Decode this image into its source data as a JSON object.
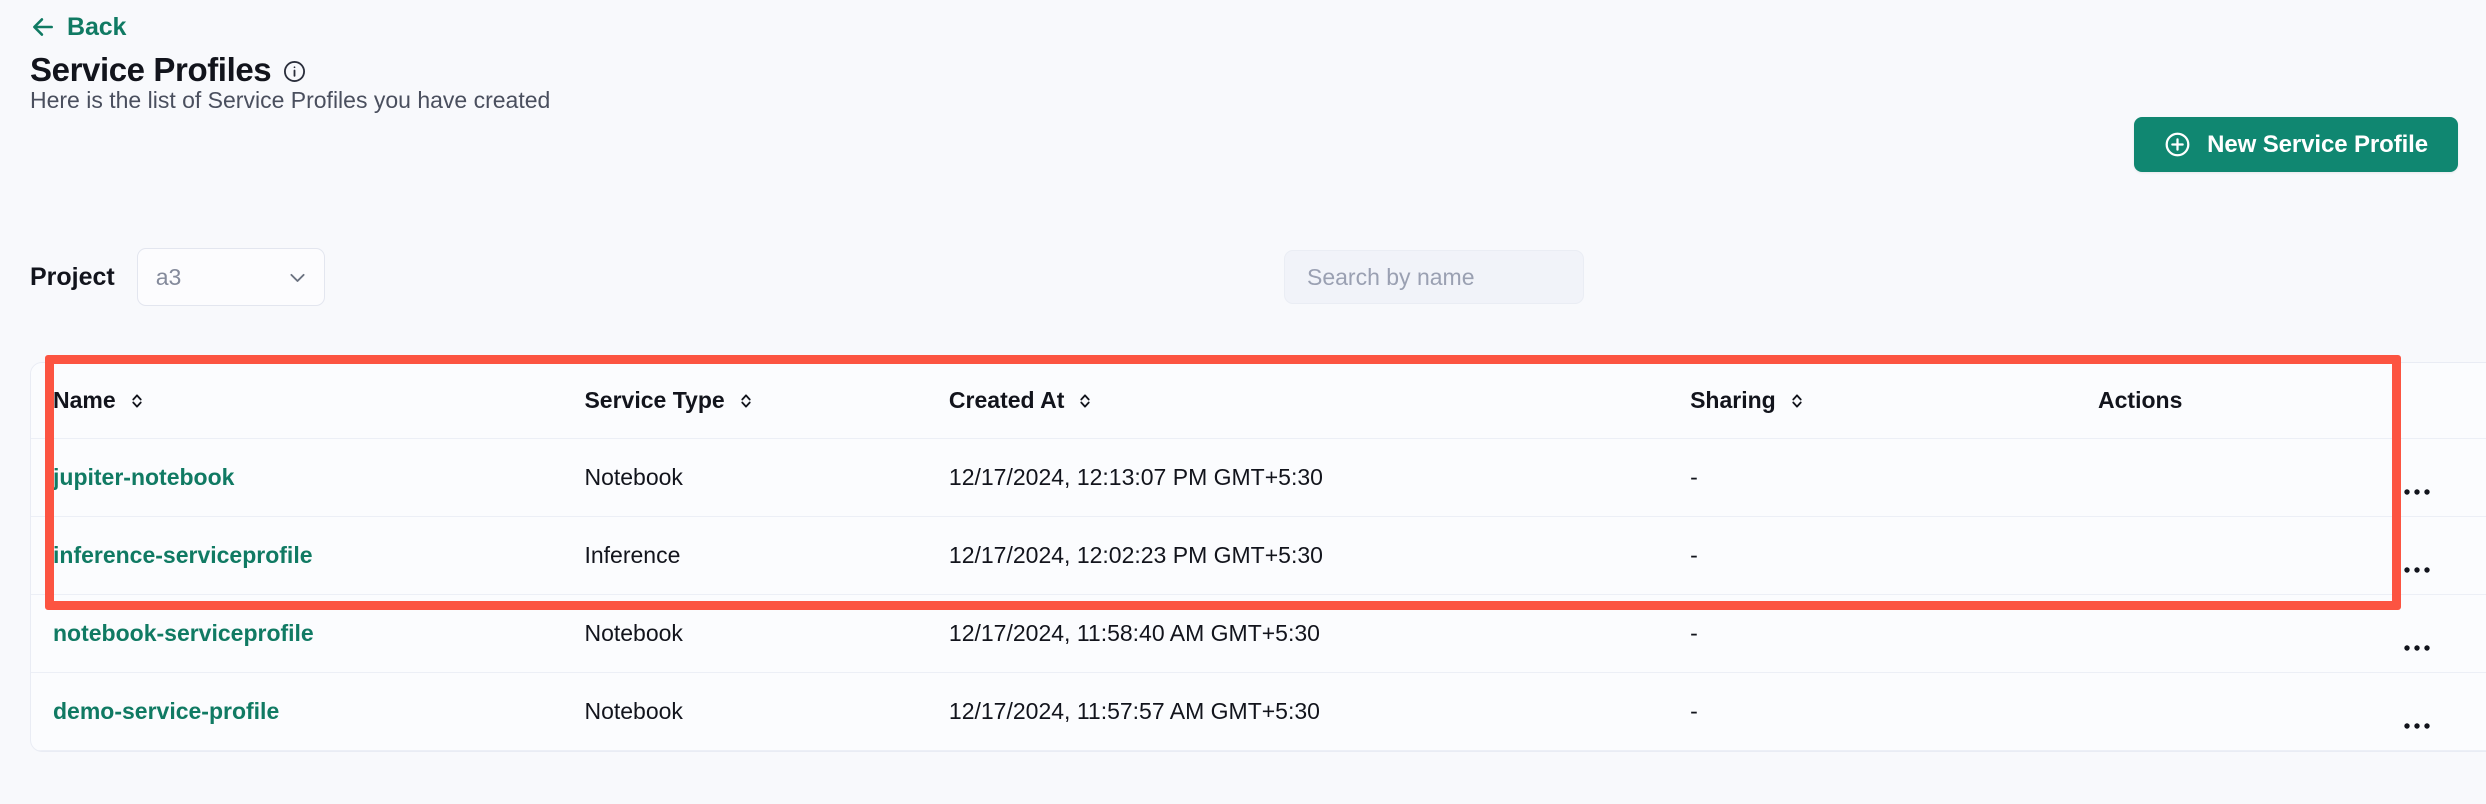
{
  "nav": {
    "back_label": "Back",
    "back_icon": "arrow-left-icon"
  },
  "header": {
    "title": "Service Profiles",
    "info_icon": "info-circle-icon",
    "subtitle": "Here is the list of Service Profiles you have created",
    "primary_button": {
      "label": "New Service Profile",
      "icon": "plus-circle-icon",
      "color": "#108771"
    }
  },
  "filters": {
    "project_label": "Project",
    "project_value": "a3",
    "project_chevron_icon": "chevron-down-icon",
    "search_placeholder": "Search by name",
    "search_value": ""
  },
  "table": {
    "columns": [
      {
        "label": "Name",
        "sortable": true,
        "sort_icon": "sort-updown-icon"
      },
      {
        "label": "Service Type",
        "sortable": true,
        "sort_icon": "sort-updown-icon"
      },
      {
        "label": "Created At",
        "sortable": true,
        "sort_icon": "sort-updown-icon"
      },
      {
        "label": "Sharing",
        "sortable": true,
        "sort_icon": "sort-updown-icon"
      },
      {
        "label": "Actions",
        "sortable": false,
        "sort_icon": ""
      }
    ],
    "rows": [
      {
        "name": "jupiter-notebook",
        "service_type": "Notebook",
        "created_at": "12/17/2024, 12:13:07 PM GMT+5:30",
        "sharing": "-",
        "actions_icon": "kebab-menu-icon"
      },
      {
        "name": "inference-serviceprofile",
        "service_type": "Inference",
        "created_at": "12/17/2024, 12:02:23 PM GMT+5:30",
        "sharing": "-",
        "actions_icon": "kebab-menu-icon"
      },
      {
        "name": "notebook-serviceprofile",
        "service_type": "Notebook",
        "created_at": "12/17/2024, 11:58:40 AM GMT+5:30",
        "sharing": "-",
        "actions_icon": "kebab-menu-icon"
      },
      {
        "name": "demo-service-profile",
        "service_type": "Notebook",
        "created_at": "12/17/2024, 11:57:57 AM GMT+5:30",
        "sharing": "-",
        "actions_icon": "kebab-menu-icon"
      }
    ]
  },
  "annotation": {
    "color": "#fc5441"
  }
}
